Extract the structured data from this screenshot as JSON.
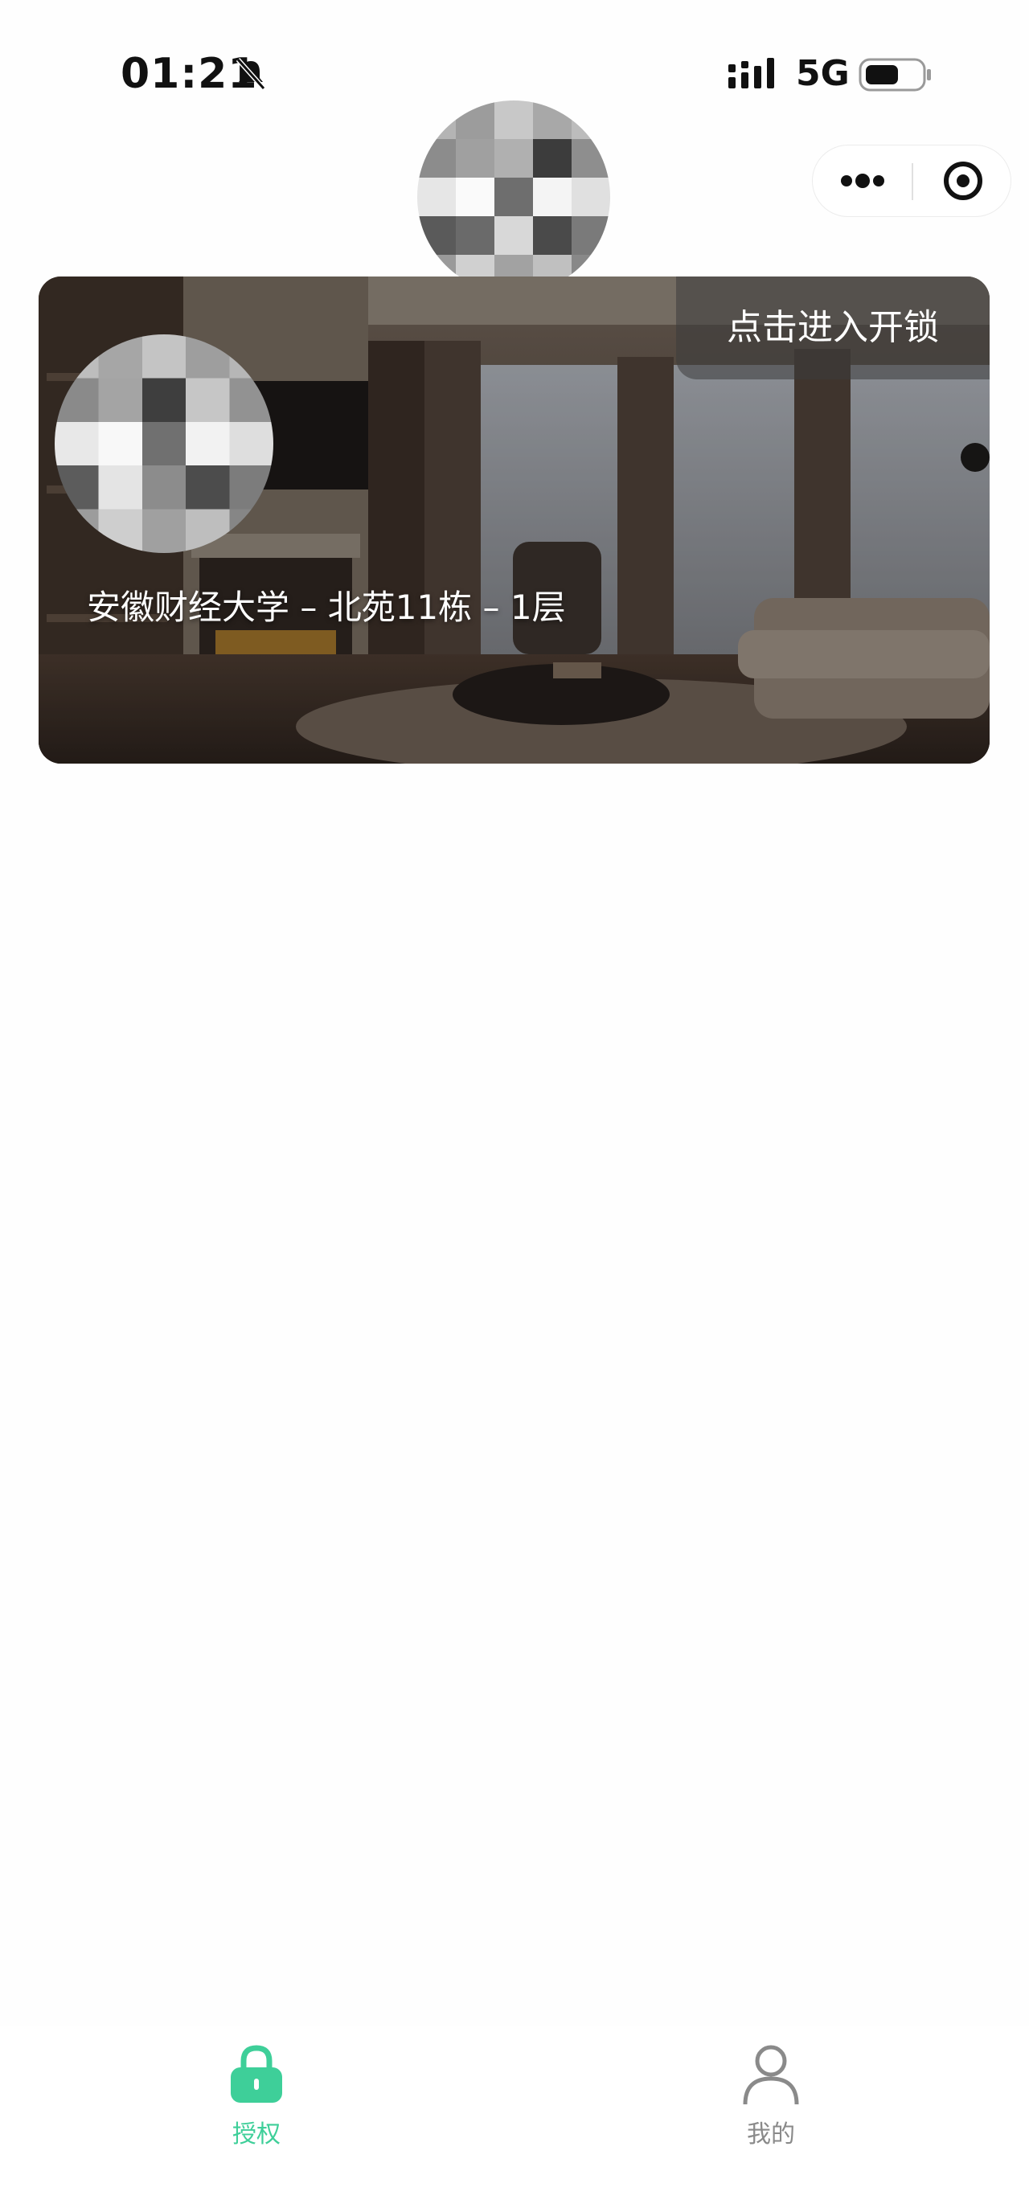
{
  "status_bar": {
    "time": "01:21",
    "network": "5G",
    "icons": [
      "mute-bell-icon",
      "signal-icon",
      "battery-icon"
    ]
  },
  "capsule": {
    "icons": [
      "more-dots-icon",
      "close-target-icon"
    ]
  },
  "room_card": {
    "unlock_label": "点击进入开锁",
    "location": "安徽财经大学 – 北苑11栋 – 1层"
  },
  "tab_bar": {
    "tabs": [
      {
        "label": "授权",
        "icon": "lock-icon",
        "active": true
      },
      {
        "label": "我的",
        "icon": "user-icon",
        "active": false
      }
    ]
  },
  "colors": {
    "accent": "#3ecf99",
    "inactive": "#8a8a8a",
    "background": "#fefefe"
  }
}
